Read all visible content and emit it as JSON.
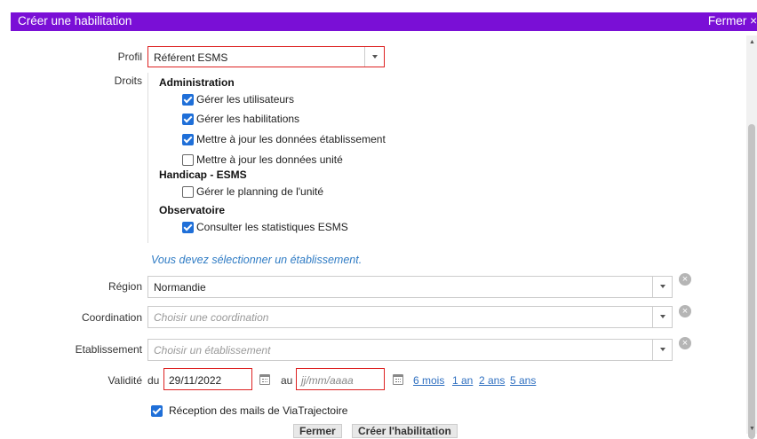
{
  "dialog": {
    "title": "Créer une habilitation",
    "close_label": "Fermer ×"
  },
  "labels": {
    "profil": "Profil",
    "droits": "Droits",
    "region": "Région",
    "coordination": "Coordination",
    "etablissement": "Etablissement",
    "validite": "Validité",
    "du": "du",
    "au": "au"
  },
  "profil": {
    "value": "Référent ESMS"
  },
  "droits": {
    "groups": [
      {
        "name": "Administration",
        "items": [
          {
            "label": "Gérer les utilisateurs",
            "checked": true
          },
          {
            "label": "Gérer les habilitations",
            "checked": true
          },
          {
            "label": "Mettre à jour les données établissement",
            "checked": true
          },
          {
            "label": "Mettre à jour les données unité",
            "checked": false
          }
        ]
      },
      {
        "name": "Handicap - ESMS",
        "items": [
          {
            "label": "Gérer le planning de l'unité",
            "checked": false
          }
        ]
      },
      {
        "name": "Observatoire",
        "items": [
          {
            "label": "Consulter les statistiques ESMS",
            "checked": true
          }
        ]
      }
    ]
  },
  "notice": "Vous devez sélectionner un établissement.",
  "region": {
    "value": "Normandie"
  },
  "coordination": {
    "placeholder": "Choisir une coordination"
  },
  "etablissement": {
    "placeholder": "Choisir un établissement"
  },
  "validite": {
    "from": "29/11/2022",
    "to_placeholder": "jj/mm/aaaa",
    "shortcuts": [
      "6 mois",
      "1 an",
      "2 ans",
      "5 ans"
    ]
  },
  "mails": {
    "label": "Réception des mails de ViaTrajectoire",
    "checked": true
  },
  "buttons": {
    "fermer": "Fermer",
    "creer": "Créer l'habilitation"
  },
  "colors": {
    "titlebar": "#7a0fd6",
    "error_border": "#dd2222",
    "checkbox": "#1f6fd8",
    "link": "#2e6fc0"
  }
}
